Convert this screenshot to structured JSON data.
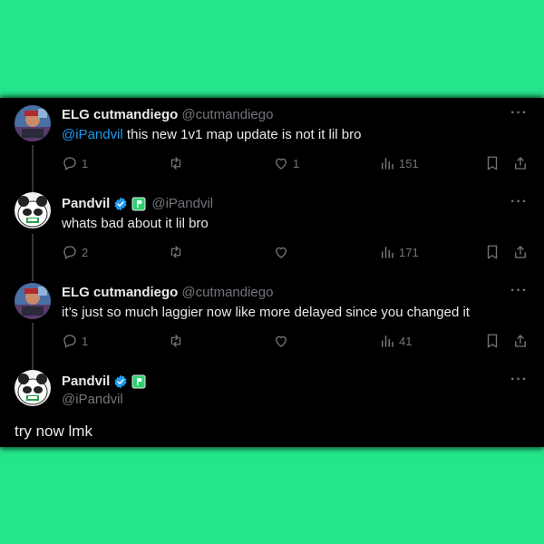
{
  "tweets": [
    {
      "name": "ELG cutmandiego",
      "handle": "@cutmandiego",
      "mention": "@iPandvil",
      "text": " this new 1v1 map update is not it lil bro",
      "replies": "1",
      "retweets": "",
      "likes": "1",
      "views": "151"
    },
    {
      "name": "Pandvil",
      "handle": "@iPandvil",
      "text": "whats bad about it lil bro",
      "replies": "2",
      "retweets": "",
      "likes": "",
      "views": "171"
    },
    {
      "name": "ELG cutmandiego",
      "handle": "@cutmandiego",
      "text": "it’s just so much laggier now like more delayed since you changed it",
      "replies": "1",
      "retweets": "",
      "likes": "",
      "views": "41"
    }
  ],
  "main_tweet": {
    "name": "Pandvil",
    "handle": "@iPandvil",
    "text": "try now lmk"
  },
  "more_label": "···",
  "colors": {
    "background": "#25E58A",
    "panel": "#000000",
    "mention": "#1d9bf0",
    "verified": "#1d9bf0",
    "muted": "#71767b"
  }
}
